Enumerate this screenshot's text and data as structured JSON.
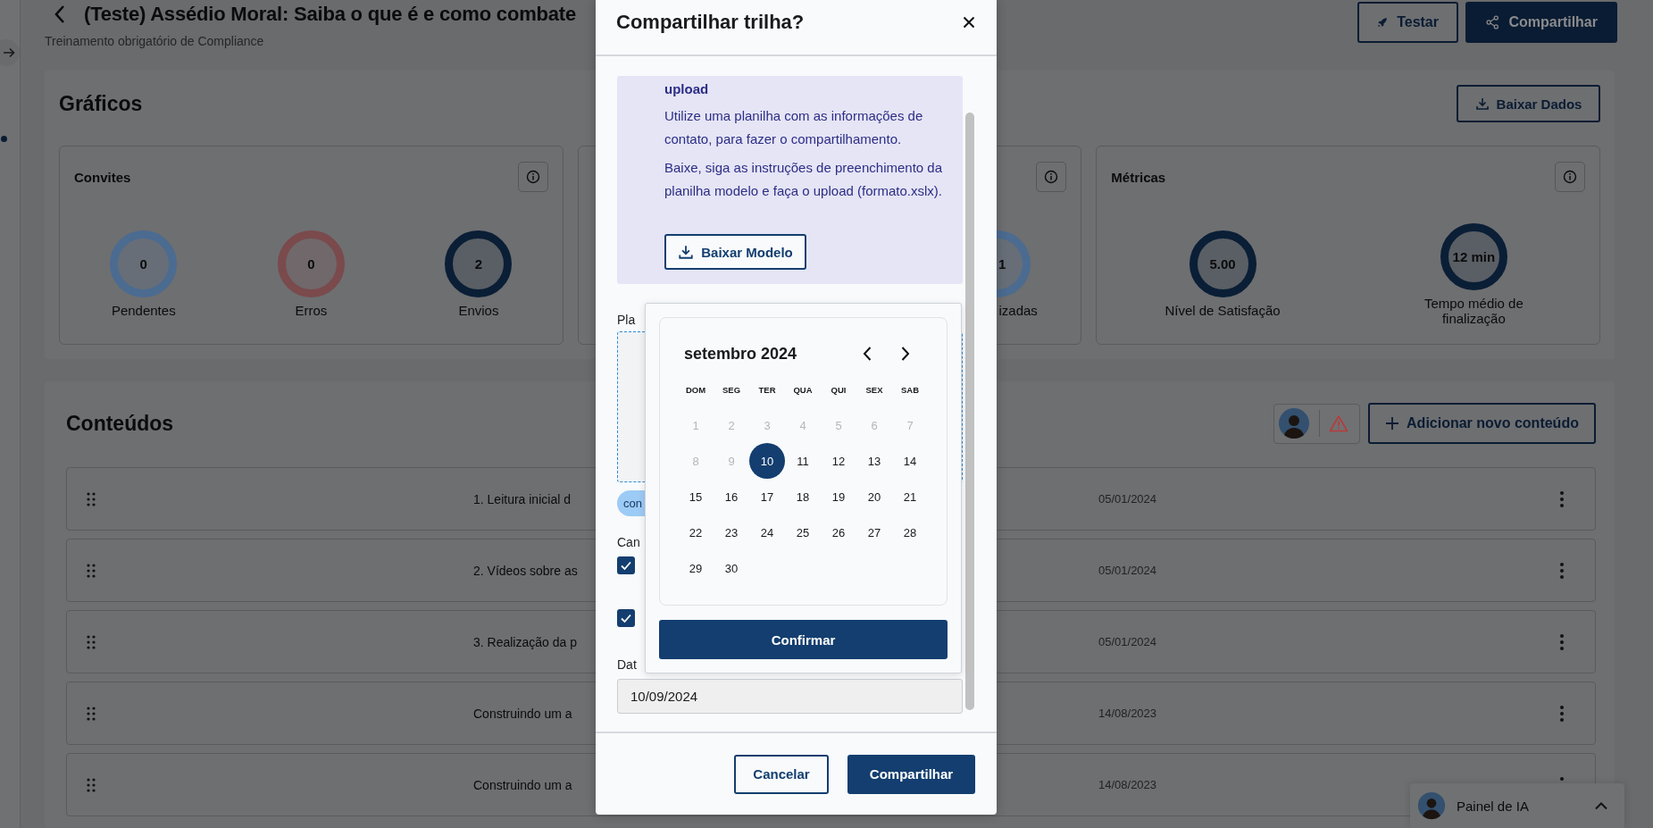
{
  "header": {
    "title": "(Teste) Assédio Moral: Saiba o que é e como combate",
    "subtitle": "Treinamento obrigatório de Compliance"
  },
  "header_buttons": [
    {
      "label": "Testar",
      "kind": "outline"
    },
    {
      "label": "Compartilhar",
      "kind": "filled"
    }
  ],
  "charts": {
    "title": "Gráficos",
    "download_button": "Baixar Dados",
    "cards": [
      {
        "kind": "full",
        "title": "Convites",
        "gauges": [
          {
            "value": "0",
            "label": "Pendentes",
            "color": "#4b6b91"
          },
          {
            "value": "0",
            "label": "Erros",
            "color": "#7a4a4c"
          },
          {
            "value": "2",
            "label": "Envios",
            "color": "#0a1e36"
          }
        ]
      },
      {
        "kind": "cut",
        "gauges": [
          {
            "value": "1",
            "label": "izadas",
            "color": "#4b6b91"
          }
        ]
      },
      {
        "kind": "full",
        "title": "Métricas",
        "gauges": [
          {
            "value": "5.00",
            "label": "Nível de Satisfação",
            "color": "#0a1e36"
          },
          {
            "value": "12 min",
            "label": "Tempo médio de finalização",
            "color": "#0a1e36"
          }
        ]
      }
    ]
  },
  "contents": {
    "title": "Conteúdos",
    "add_button": "Adicionar novo conteúdo",
    "rows": [
      {
        "title": "1. Leitura inicial d",
        "date": "05/01/2024"
      },
      {
        "title": "2. Vídeos sobre as",
        "date": "05/01/2024"
      },
      {
        "title": "3. Realização da p",
        "date": "05/01/2024"
      },
      {
        "title": "Construindo um a",
        "date": "14/08/2023"
      },
      {
        "title": "Construindo um a",
        "date": "14/08/2023"
      }
    ]
  },
  "ai_panel": {
    "label": "Painel de IA"
  },
  "modal": {
    "title": "Compartilhar trilha?",
    "info": {
      "heading": "upload",
      "paragraphs": [
        "Utilize uma planilha com as informações de contato, para fazer o compartilhamento.",
        "Baixe, siga as instruções de preenchimento da planilha modelo e faça o upload (formato.xslx)."
      ],
      "button": "Baixar Modelo"
    },
    "spreadsheet_label": "Pla",
    "chip": "con",
    "channels_label": "Can",
    "checkboxes": [
      {
        "checked": true
      },
      {
        "checked": true
      }
    ],
    "date_label": "Dat",
    "date_value": "10/09/2024",
    "cancel": "Cancelar",
    "submit": "Compartilhar"
  },
  "date_picker": {
    "month": "setembro 2024",
    "weekdays": [
      "DOM",
      "SEG",
      "TER",
      "QUA",
      "QUI",
      "SEX",
      "SAB"
    ],
    "confirm": "Confirmar",
    "days": [
      {
        "label": "1",
        "disabled": true,
        "selected": false
      },
      {
        "label": "2",
        "disabled": true,
        "selected": false
      },
      {
        "label": "3",
        "disabled": true,
        "selected": false
      },
      {
        "label": "4",
        "disabled": true,
        "selected": false
      },
      {
        "label": "5",
        "disabled": true,
        "selected": false
      },
      {
        "label": "6",
        "disabled": true,
        "selected": false
      },
      {
        "label": "7",
        "disabled": true,
        "selected": false
      },
      {
        "label": "8",
        "disabled": true,
        "selected": false
      },
      {
        "label": "9",
        "disabled": true,
        "selected": false
      },
      {
        "label": "10",
        "disabled": false,
        "selected": true
      },
      {
        "label": "11",
        "disabled": false,
        "selected": false
      },
      {
        "label": "12",
        "disabled": false,
        "selected": false
      },
      {
        "label": "13",
        "disabled": false,
        "selected": false
      },
      {
        "label": "14",
        "disabled": false,
        "selected": false
      },
      {
        "label": "15",
        "disabled": false,
        "selected": false
      },
      {
        "label": "16",
        "disabled": false,
        "selected": false
      },
      {
        "label": "17",
        "disabled": false,
        "selected": false
      },
      {
        "label": "18",
        "disabled": false,
        "selected": false
      },
      {
        "label": "19",
        "disabled": false,
        "selected": false
      },
      {
        "label": "20",
        "disabled": false,
        "selected": false
      },
      {
        "label": "21",
        "disabled": false,
        "selected": false
      },
      {
        "label": "22",
        "disabled": false,
        "selected": false
      },
      {
        "label": "23",
        "disabled": false,
        "selected": false
      },
      {
        "label": "24",
        "disabled": false,
        "selected": false
      },
      {
        "label": "25",
        "disabled": false,
        "selected": false
      },
      {
        "label": "26",
        "disabled": false,
        "selected": false
      },
      {
        "label": "27",
        "disabled": false,
        "selected": false
      },
      {
        "label": "28",
        "disabled": false,
        "selected": false
      },
      {
        "label": "29",
        "disabled": false,
        "selected": false
      },
      {
        "label": "30",
        "disabled": false,
        "selected": false
      }
    ]
  }
}
